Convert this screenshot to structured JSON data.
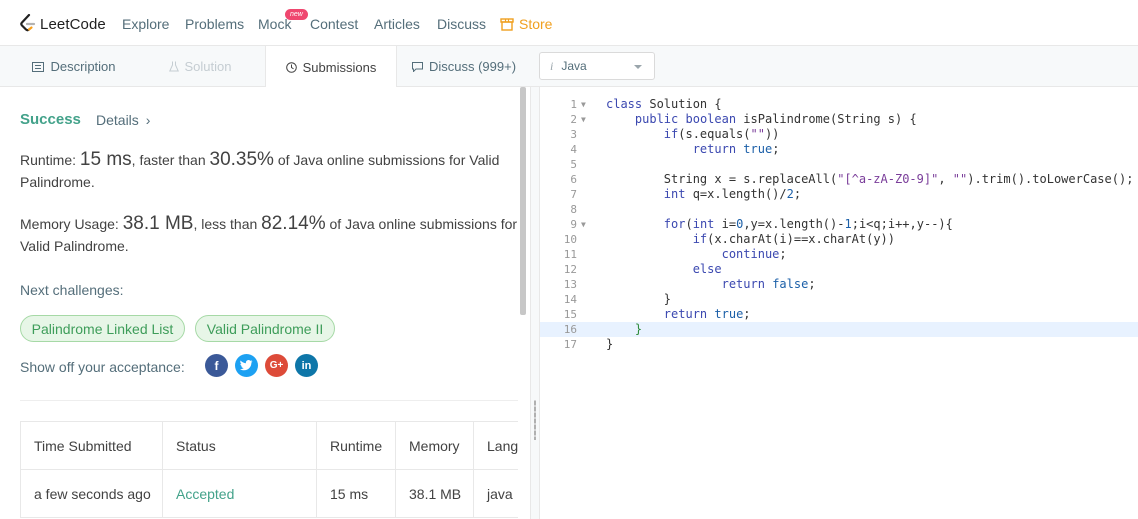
{
  "nav": {
    "logo_text": "LeetCode",
    "items": [
      "Explore",
      "Problems",
      "Mock",
      "Contest",
      "Articles",
      "Discuss"
    ],
    "mock_badge": "new",
    "store_label": "Store",
    "accent_color": "#f0a020",
    "badge_color": "#ef476f"
  },
  "tabs": {
    "description": "Description",
    "solution": "Solution",
    "submissions": "Submissions",
    "discuss": "Discuss (999+)",
    "language": "Java",
    "language_icon": "i"
  },
  "result": {
    "status": "Success",
    "details": "Details",
    "details_chevron": "›",
    "runtime_label": "Runtime: ",
    "runtime_value": "15 ms",
    "runtime_mid": ", faster than ",
    "runtime_pct": "30.35%",
    "runtime_tail": " of Java online submissions for Valid Palindrome.",
    "memory_label": "Memory Usage: ",
    "memory_value": "38.1 MB",
    "memory_mid": ", less than ",
    "memory_pct": "82.14%",
    "memory_tail": " of Java online submissions for Valid Palindrome.",
    "success_color": "#43a28a"
  },
  "next": {
    "label": "Next challenges:",
    "challenges": [
      "Palindrome Linked List",
      "Valid Palindrome II"
    ]
  },
  "share": {
    "label": "Show off your acceptance:",
    "icons": [
      {
        "name": "facebook-icon",
        "glyph": "f",
        "color": "#3b5998"
      },
      {
        "name": "twitter-icon",
        "glyph": "t",
        "color": "#1da1f2"
      },
      {
        "name": "google-plus-icon",
        "glyph": "G+",
        "color": "#dd4b39"
      },
      {
        "name": "linkedin-icon",
        "glyph": "in",
        "color": "#0e76a8"
      }
    ]
  },
  "table": {
    "headers": [
      "Time Submitted",
      "Status",
      "Runtime",
      "Memory",
      "Language"
    ],
    "rows": [
      [
        "a few seconds ago",
        "Accepted",
        "15 ms",
        "38.1 MB",
        "java"
      ]
    ]
  },
  "code": {
    "lines": [
      "class Solution {",
      "    public boolean isPalindrome(String s) {",
      "        if(s.equals(\"\"))",
      "            return true;",
      "",
      "        String x = s.replaceAll(\"[^a-zA-Z0-9]\", \"\").trim().toLowerCase();",
      "        int q=x.length()/2;",
      "",
      "        for(int i=0,y=x.length()-1;i<q;i++,y--){",
      "            if(x.charAt(i)==x.charAt(y))",
      "                continue;",
      "            else",
      "                return false;",
      "        }",
      "        return true;",
      "    }",
      "}"
    ],
    "fold_lines": [
      1,
      2,
      9
    ],
    "highlight_line": 16
  }
}
